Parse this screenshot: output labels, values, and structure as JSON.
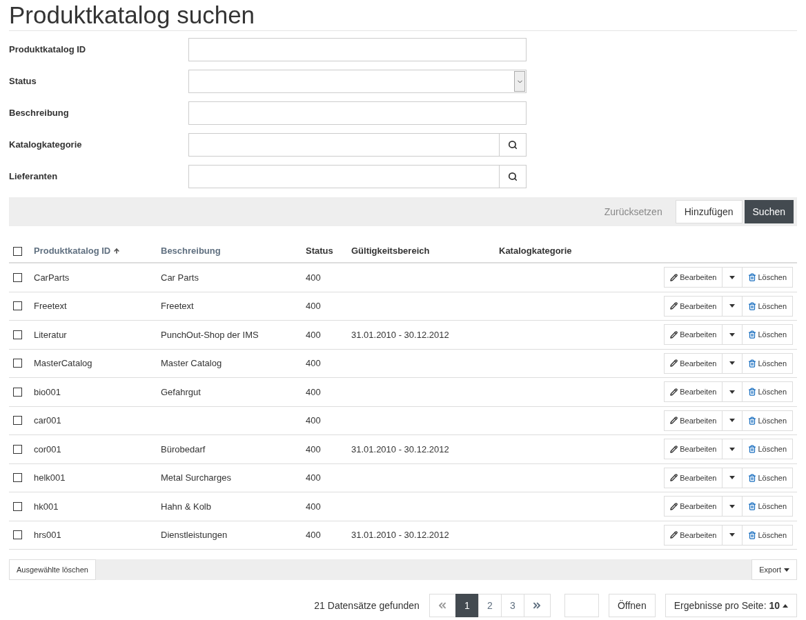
{
  "title": "Produktkatalog suchen",
  "form": [
    {
      "label": "Produktkatalog ID",
      "kind": "text"
    },
    {
      "label": "Status",
      "kind": "select"
    },
    {
      "label": "Beschreibung",
      "kind": "text"
    },
    {
      "label": "Katalogkategorie",
      "kind": "lookup"
    },
    {
      "label": "Lieferanten",
      "kind": "lookup"
    }
  ],
  "form_actions": {
    "reset": "Zurücksetzen",
    "add": "Hinzufügen",
    "search": "Suchen"
  },
  "table": {
    "select_all_checked": false,
    "columns": [
      {
        "label": "Produktkatalog ID",
        "sortable": true,
        "sorted": true
      },
      {
        "label": "Beschreibung",
        "sortable": true,
        "sorted": false
      },
      {
        "label": "Status",
        "sortable": false,
        "sorted": false
      },
      {
        "label": "Gültigkeitsbereich",
        "sortable": false,
        "sorted": false
      },
      {
        "label": "Katalogkategorie",
        "sortable": false,
        "sorted": false
      }
    ],
    "rows": [
      {
        "checked": false,
        "cells": [
          "CarParts",
          "Car Parts",
          "400",
          "",
          ""
        ],
        "edit": "Bearbeiten",
        "delete": "Löschen"
      },
      {
        "checked": false,
        "cells": [
          "Freetext",
          "Freetext",
          "400",
          "",
          ""
        ],
        "edit": "Bearbeiten",
        "delete": "Löschen"
      },
      {
        "checked": false,
        "cells": [
          "Literatur",
          "PunchOut-Shop der IMS",
          "400",
          "31.01.2010 - 30.12.2012",
          ""
        ],
        "edit": "Bearbeiten",
        "delete": "Löschen"
      },
      {
        "checked": false,
        "cells": [
          "MasterCatalog",
          "Master Catalog",
          "400",
          "",
          ""
        ],
        "edit": "Bearbeiten",
        "delete": "Löschen"
      },
      {
        "checked": false,
        "cells": [
          "bio001",
          "Gefahrgut",
          "400",
          "",
          ""
        ],
        "edit": "Bearbeiten",
        "delete": "Löschen"
      },
      {
        "checked": false,
        "cells": [
          "car001",
          "",
          "400",
          "",
          ""
        ],
        "edit": "Bearbeiten",
        "delete": "Löschen"
      },
      {
        "checked": false,
        "cells": [
          "cor001",
          "Bürobedarf",
          "400",
          "31.01.2010 - 30.12.2012",
          ""
        ],
        "edit": "Bearbeiten",
        "delete": "Löschen"
      },
      {
        "checked": false,
        "cells": [
          "helk001",
          "Metal Surcharges",
          "400",
          "",
          ""
        ],
        "edit": "Bearbeiten",
        "delete": "Löschen"
      },
      {
        "checked": false,
        "cells": [
          "hk001",
          "Hahn & Kolb",
          "400",
          "",
          ""
        ],
        "edit": "Bearbeiten",
        "delete": "Löschen"
      },
      {
        "checked": false,
        "cells": [
          "hrs001",
          "Dienstleistungen",
          "400",
          "31.01.2010 - 30.12.2012",
          ""
        ],
        "edit": "Bearbeiten",
        "delete": "Löschen"
      }
    ]
  },
  "bulk": {
    "delete_selected": "Ausgewählte löschen",
    "export": "Export"
  },
  "footer": {
    "count": "21 Datensätze gefunden",
    "pages": [
      {
        "label": "1",
        "selected": true
      },
      {
        "label": "2",
        "selected": false
      },
      {
        "label": "3",
        "selected": false
      }
    ],
    "open": "Öffnen",
    "per_page": "Ergebnisse pro Seite: **10**"
  }
}
